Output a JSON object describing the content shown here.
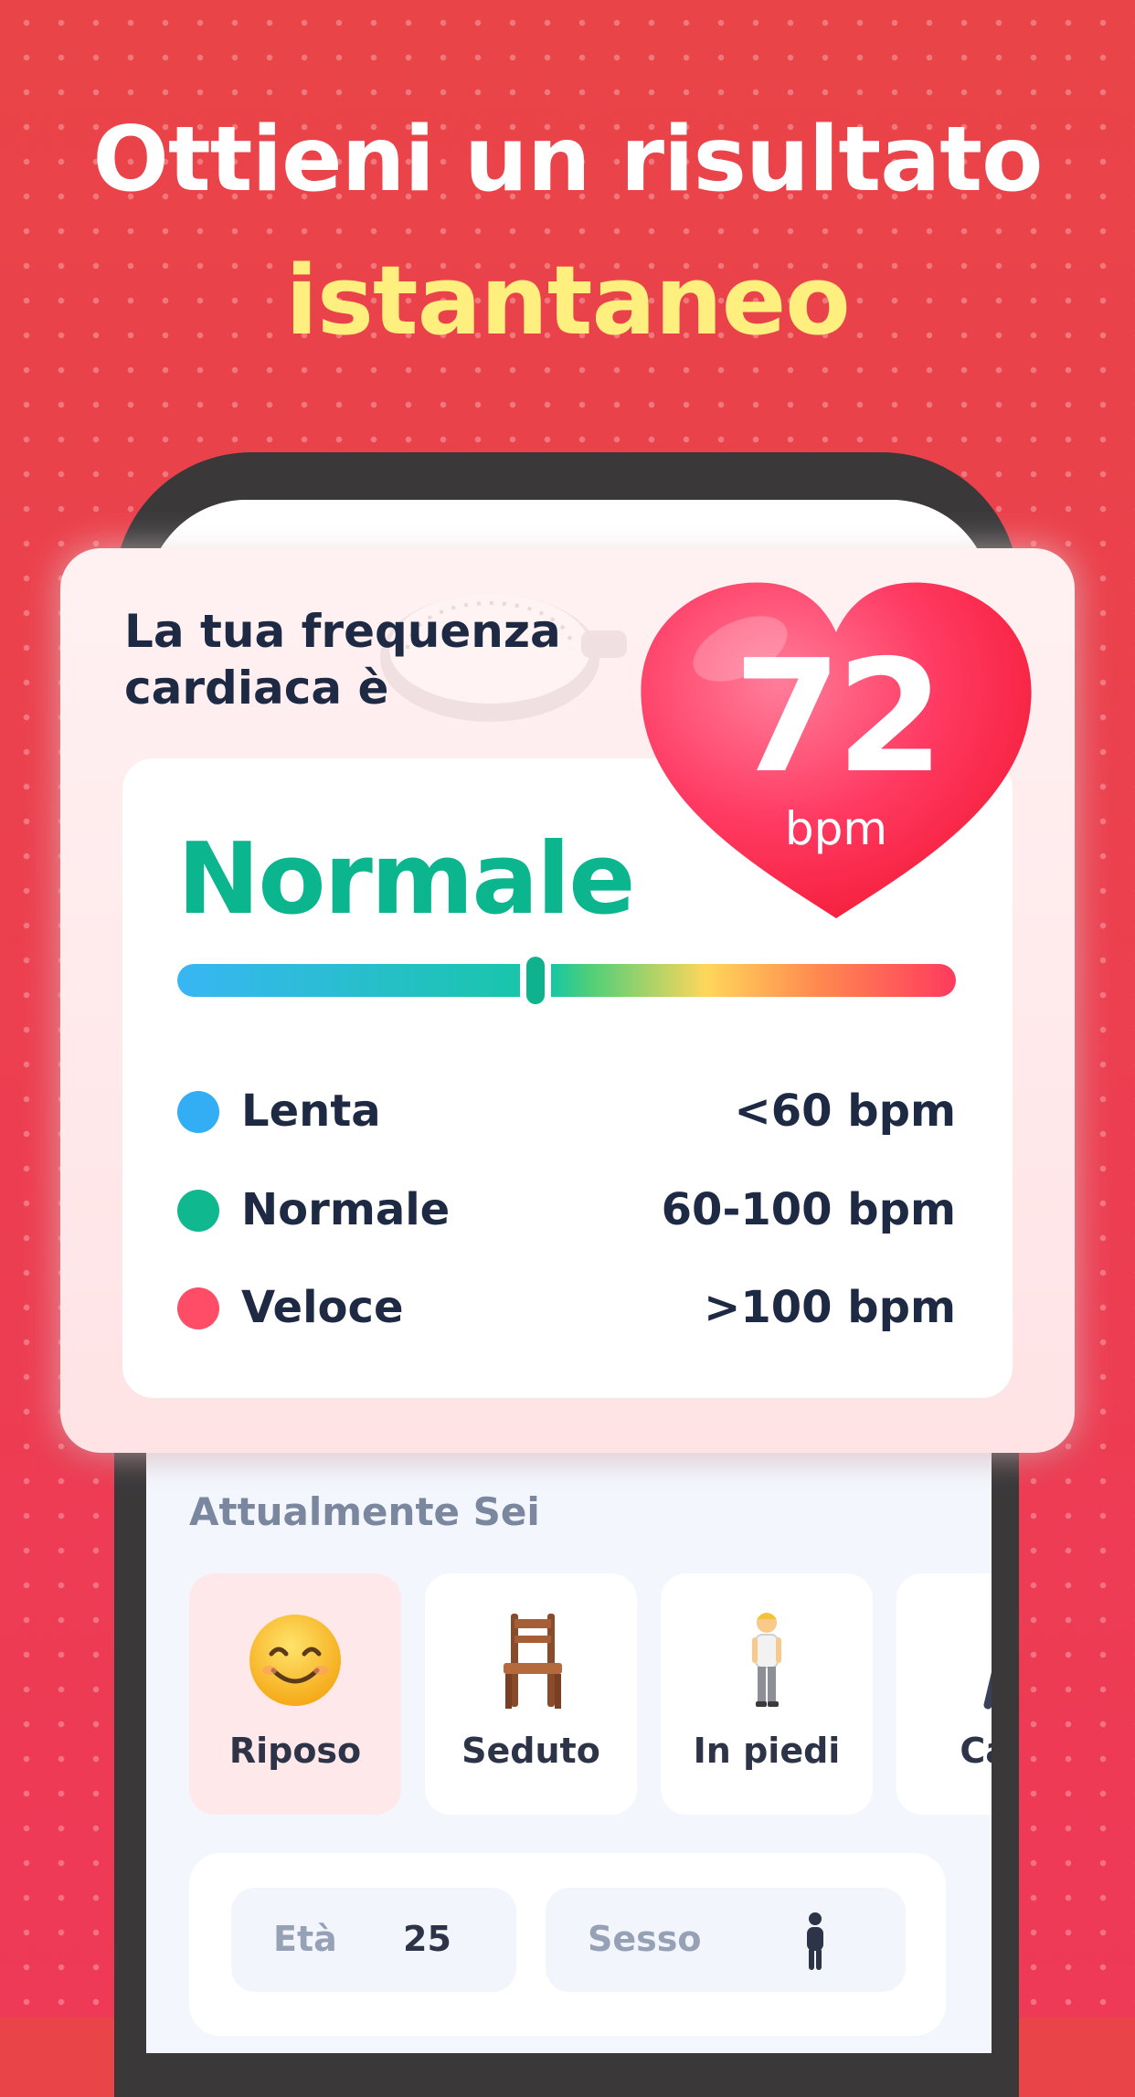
{
  "headline": {
    "line1": "Ottieni un risultato",
    "line2": "istantaneo"
  },
  "result_card": {
    "title": "La tua frequenza cardiaca è",
    "bpm_value": "72",
    "bpm_unit": "bpm",
    "status": "Normale",
    "indicator_level": 0.46,
    "legend": [
      {
        "label": "Lenta",
        "value": "<60 bpm",
        "color": "#33aef5"
      },
      {
        "label": "Normale",
        "value": "60-100 bpm",
        "color": "#0fb88f"
      },
      {
        "label": "Veloce",
        "value": ">100 bpm",
        "color": "#ff4d67"
      }
    ]
  },
  "activity": {
    "section_label": "Attualmente Sei",
    "states": [
      {
        "label": "Riposo",
        "icon": "smiling-face-icon",
        "selected": true
      },
      {
        "label": "Seduto",
        "icon": "chair-icon",
        "selected": false
      },
      {
        "label": "In piedi",
        "icon": "standing-person-icon",
        "selected": false
      },
      {
        "label": "Cam",
        "icon": "walking-person-icon",
        "selected": false
      }
    ]
  },
  "profile": {
    "age_label": "Età",
    "age_value": "25",
    "sex_label": "Sesso",
    "sex_icon": "person-icon"
  },
  "colors": {
    "background": "#ec3f4f",
    "headline_accent": "#ffef7f",
    "status_green": "#0bb58e",
    "heart": "#ff2f55"
  }
}
